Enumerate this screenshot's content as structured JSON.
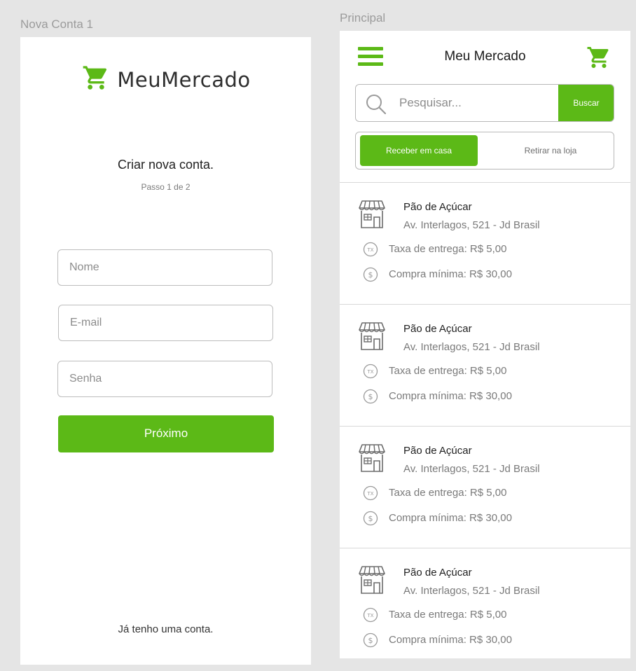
{
  "colors": {
    "accent": "#5cb917",
    "background": "#e5e5e5"
  },
  "frames": {
    "left_title": "Nova Conta 1",
    "right_title": "Principal"
  },
  "signup": {
    "logo_text": "MeuMercado",
    "logo_icon": "cart-icon",
    "title": "Criar nova conta.",
    "step": "Passo 1 de 2",
    "name_placeholder": "Nome",
    "email_placeholder": "E-mail",
    "password_placeholder": "Senha",
    "next_label": "Próximo",
    "login_link": "Já tenho uma conta."
  },
  "main": {
    "header_title": "Meu Mercado",
    "search_placeholder": "Pesquisar...",
    "search_button": "Buscar",
    "tabs": [
      {
        "label": "Receber em casa",
        "active": true
      },
      {
        "label": "Retirar na loja",
        "active": false
      }
    ],
    "stores": [
      {
        "name": "Pão de Açúcar",
        "address": "Av. Interlagos, 521 - Jd Brasil",
        "fee": "Taxa de entrega: R$ 5,00",
        "minimum": "Compra mínima: R$ 30,00"
      },
      {
        "name": "Pão de Açúcar",
        "address": "Av. Interlagos, 521 - Jd Brasil",
        "fee": "Taxa de entrega: R$ 5,00",
        "minimum": "Compra mínima: R$ 30,00"
      },
      {
        "name": "Pão de Açúcar",
        "address": "Av. Interlagos, 521 - Jd Brasil",
        "fee": "Taxa de entrega: R$ 5,00",
        "minimum": "Compra mínima: R$ 30,00"
      },
      {
        "name": "Pão de Açúcar",
        "address": "Av. Interlagos, 521 - Jd Brasil",
        "fee": "Taxa de entrega: R$ 5,00",
        "minimum": "Compra mínima: R$ 30,00"
      }
    ]
  }
}
